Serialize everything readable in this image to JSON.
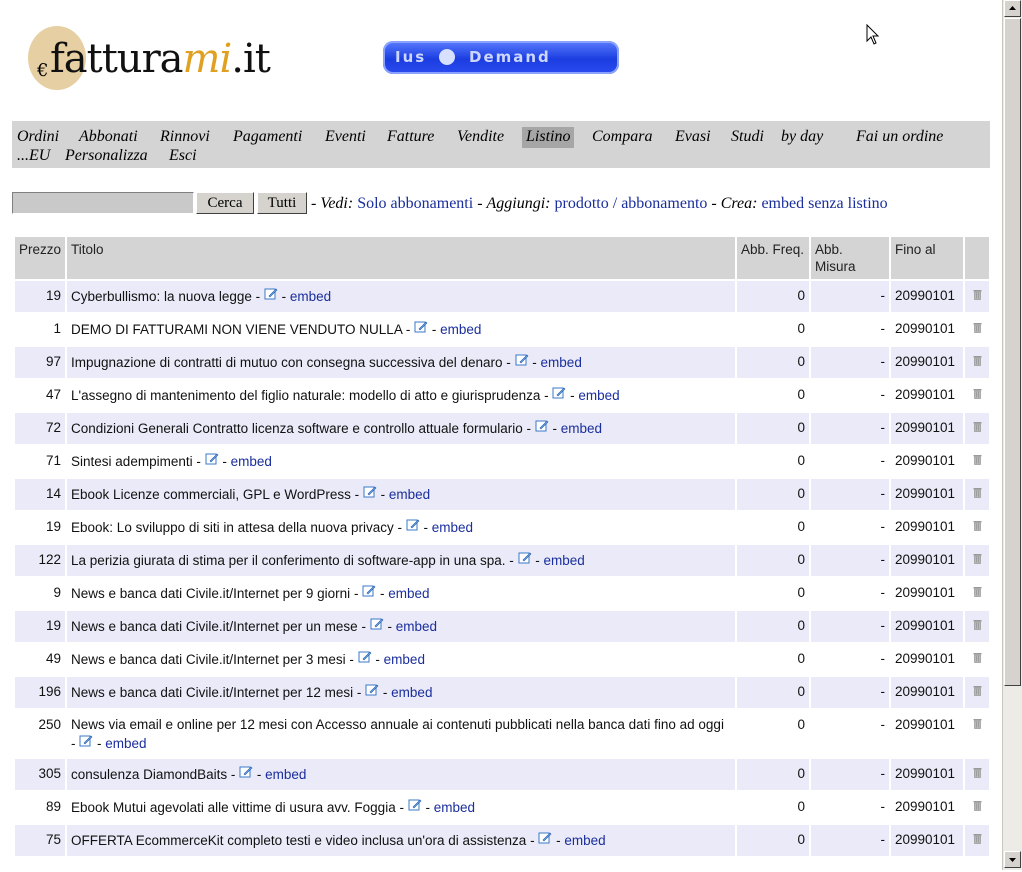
{
  "logo": {
    "euro": "€",
    "text_main": "fattura",
    "text_mi": "mi",
    "text_tld": ".it"
  },
  "banner": {
    "left": "Ius",
    "right": "Demand"
  },
  "menu": {
    "items": [
      "Ordini",
      "Abbonati",
      "Rinnovi",
      "Pagamenti",
      "Eventi",
      "Fatture",
      "Vendite",
      "Listino",
      "Compara",
      "Evasi",
      "Studi",
      "by day",
      "Fai un ordine",
      "...EU",
      "Personalizza",
      "Esci"
    ],
    "active": "Listino"
  },
  "search": {
    "value": "",
    "cerca_label": "Cerca",
    "tutti_label": "Tutti",
    "vedi_label": "Vedi:",
    "solo_abbonamenti": "Solo abbonamenti",
    "aggiungi_label": "Aggiungi:",
    "prodotto": "prodotto",
    "slash": "/",
    "abbonamento": "abbonamento",
    "crea_label": "Crea:",
    "embed_senza_listino": "embed senza listino"
  },
  "table": {
    "headers": {
      "prezzo": "Prezzo",
      "titolo": "Titolo",
      "abb_freq": "Abb. Freq.",
      "abb_misura": "Abb. Misura",
      "fino_al": "Fino al"
    },
    "embed_label": "embed",
    "rows": [
      {
        "prezzo": "19",
        "titolo": "Cyberbullismo: la nuova legge",
        "freq": "0",
        "misura": "-",
        "fino": "20990101"
      },
      {
        "prezzo": "1",
        "titolo": "DEMO DI FATTURAMI NON VIENE VENDUTO NULLA",
        "freq": "0",
        "misura": "-",
        "fino": "20990101"
      },
      {
        "prezzo": "97",
        "titolo": "Impugnazione di contratti di mutuo con consegna successiva del denaro",
        "freq": "0",
        "misura": "-",
        "fino": "20990101"
      },
      {
        "prezzo": "47",
        "titolo": "L'assegno di mantenimento del figlio naturale: modello di atto e giurisprudenza",
        "freq": "0",
        "misura": "-",
        "fino": "20990101"
      },
      {
        "prezzo": "72",
        "titolo": "Condizioni Generali Contratto licenza software e controllo attuale formulario",
        "freq": "0",
        "misura": "-",
        "fino": "20990101"
      },
      {
        "prezzo": "71",
        "titolo": "Sintesi adempimenti",
        "freq": "0",
        "misura": "-",
        "fino": "20990101"
      },
      {
        "prezzo": "14",
        "titolo": "Ebook Licenze commerciali, GPL e WordPress",
        "freq": "0",
        "misura": "-",
        "fino": "20990101"
      },
      {
        "prezzo": "19",
        "titolo": "Ebook: Lo sviluppo di siti in attesa della nuova privacy",
        "freq": "0",
        "misura": "-",
        "fino": "20990101"
      },
      {
        "prezzo": "122",
        "titolo": "La perizia giurata di stima per il conferimento di software-app in una spa.",
        "freq": "0",
        "misura": "-",
        "fino": "20990101"
      },
      {
        "prezzo": "9",
        "titolo": "News e banca dati Civile.it/Internet per 9 giorni",
        "freq": "0",
        "misura": "-",
        "fino": "20990101"
      },
      {
        "prezzo": "19",
        "titolo": "News e banca dati Civile.it/Internet per un mese",
        "freq": "0",
        "misura": "-",
        "fino": "20990101"
      },
      {
        "prezzo": "49",
        "titolo": "News e banca dati Civile.it/Internet per 3 mesi",
        "freq": "0",
        "misura": "-",
        "fino": "20990101"
      },
      {
        "prezzo": "196",
        "titolo": "News e banca dati Civile.it/Internet per 12 mesi",
        "freq": "0",
        "misura": "-",
        "fino": "20990101"
      },
      {
        "prezzo": "250",
        "titolo": "News via email e online per 12 mesi con Accesso annuale ai contenuti pubblicati nella banca dati fino ad oggi",
        "freq": "0",
        "misura": "-",
        "fino": "20990101"
      },
      {
        "prezzo": "305",
        "titolo": "consulenza DiamondBaits",
        "freq": "0",
        "misura": "-",
        "fino": "20990101"
      },
      {
        "prezzo": "89",
        "titolo": "Ebook Mutui agevolati alle vittime di usura avv. Foggia",
        "freq": "0",
        "misura": "-",
        "fino": "20990101"
      },
      {
        "prezzo": "75",
        "titolo": "OFFERTA EcommerceKit completo testi e video inclusa un'ora di assistenza",
        "freq": "0",
        "misura": "-",
        "fino": "20990101"
      }
    ]
  },
  "colors": {
    "link": "#1a2e9c",
    "row_alt": "#eaeaf8",
    "header_bg": "#d4d4d4",
    "menu_bg": "#d4d4d4"
  }
}
